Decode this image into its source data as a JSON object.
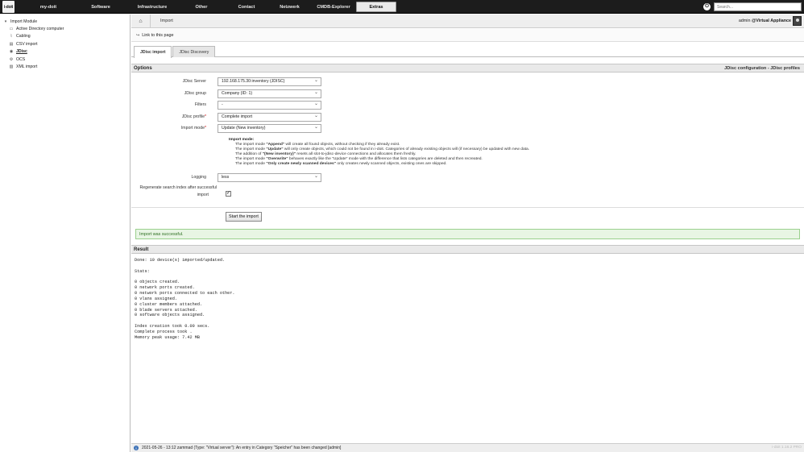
{
  "topbar": {
    "logo": "i-doit",
    "nav": [
      {
        "label": "my-doit",
        "width": 66
      },
      {
        "label": "Software",
        "width": 64
      },
      {
        "label": "Infrastructure",
        "width": 64
      },
      {
        "label": "Other",
        "width": 58
      },
      {
        "label": "Contact",
        "width": 54
      },
      {
        "label": "Netzwerk",
        "width": 53
      },
      {
        "label": "CMDB-Explorer",
        "width": 56
      },
      {
        "label": "Extras",
        "width": 50
      }
    ],
    "active_index": 7,
    "search_placeholder": "Search...",
    "power_icon": "power-icon"
  },
  "tree": [
    {
      "label": "Import Module",
      "icon": "folder-open-icon",
      "glyph": "▾",
      "level": "root"
    },
    {
      "label": "Active Directory computer",
      "icon": "computer-icon",
      "glyph": "▭",
      "level": "child"
    },
    {
      "label": "Cabling",
      "icon": "cable-icon",
      "glyph": "⌇",
      "level": "child"
    },
    {
      "label": "CSV import",
      "icon": "csv-icon",
      "glyph": "▤",
      "level": "child"
    },
    {
      "label": "JDisc",
      "icon": "jdisc-icon",
      "glyph": "◉",
      "level": "child",
      "current": true
    },
    {
      "label": "OCS",
      "icon": "ocs-icon",
      "glyph": "⚙",
      "level": "child"
    },
    {
      "label": "XML import",
      "icon": "xml-icon",
      "glyph": "▨",
      "level": "child"
    }
  ],
  "breadcrumb": {
    "home_icon": "home-icon",
    "item": "Import",
    "user": "admin",
    "tenant": "@Virtual Appliance"
  },
  "link_row": {
    "label": "Link to this page"
  },
  "tabs": [
    {
      "label": "JDisc import",
      "active": true
    },
    {
      "label": "JDisc Discovery",
      "active": false
    }
  ],
  "options": {
    "title": "Options",
    "right_title": "JDisc configuration - JDisc profiles",
    "fields": [
      {
        "label": "JDisc Server",
        "value": "192.168.175.30:inventory (JDISC)",
        "required": false
      },
      {
        "label": "JDisc group",
        "value": "Company (ID: 1)",
        "required": false
      },
      {
        "label": "Filters",
        "value": "-",
        "required": false
      },
      {
        "label": "JDisc profile",
        "value": "Complete import",
        "required": true
      },
      {
        "label": "Import mode",
        "value": "Update (New inventory)",
        "required": true
      }
    ],
    "help": {
      "heading": "Import mode:",
      "lines": [
        [
          "The import mode ",
          "\"Append\"",
          " will create all found objects, without checking if they already exist."
        ],
        [
          "The import mode ",
          "\"Update\"",
          " will only create objects, which could not be found in i-doit. Categories of already existing objects will (if necessary) be updated with new data."
        ],
        [
          "The addition of ",
          "\"(New inventory)\"",
          " resets all slot-to-jdisc-device connections and allocates them freshly."
        ],
        [
          "The import mode ",
          "\"Overwrite\"",
          " behaves exactly like the \"Update\" mode with the difference that lists categories are deleted and then recreated."
        ],
        [
          "The import mode ",
          "\"Only create newly scanned devices\"",
          " only creates newly scanned objects, existing ones are skipped."
        ]
      ]
    },
    "logging": {
      "label": "Logging",
      "value": "less"
    },
    "regenerate": {
      "line1": "Regenerate search index after successful",
      "line2": "import",
      "checked_glyph": "✓"
    },
    "start_button": "Start the import"
  },
  "success_message": "Import was successful.",
  "result": {
    "title": "Result",
    "text": "Done: 10 device(s) imported/updated.\n\nStats:\n\n0 objects created.\n0 network ports created.\n0 network ports connected to each other.\n0 vlans assigned.\n0 cluster members attached.\n0 blade servers attached.\n0 software objects assigned.\n\nIndex creation took 0.00 secs.\nComplete process took .\nMemory peak usage: 7.42 MB"
  },
  "statusbar": {
    "message": "2021-05-26 - 13:12 zammad (Type: \"Virtual server\"): An entry in Category \"Speicher\" has been changed [admin]",
    "version": "i-doit 1.16.2 PRO"
  }
}
